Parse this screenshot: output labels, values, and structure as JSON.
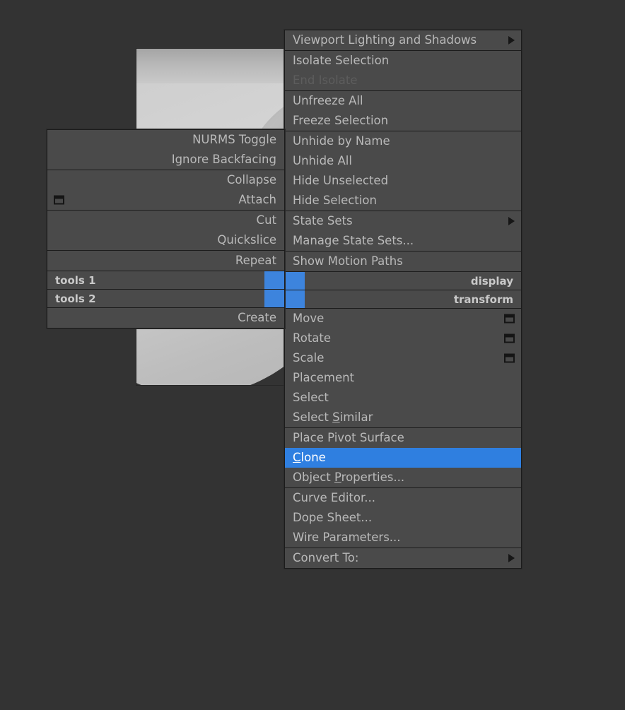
{
  "app": {
    "background_color": "#333333",
    "menu_bg_color": "#4a4a4a",
    "menu_text_color": "#b9b9b9",
    "disabled_text_color": "#5d5d5d",
    "highlight_color": "#2f7fe0",
    "swatch_color": "#3d84dd"
  },
  "viewport": {
    "object_name": "brake-disc-3d-object"
  },
  "quad_menu": {
    "upper_right": {
      "title": "display",
      "groups": [
        {
          "items": [
            {
              "label": "Viewport Lighting and Shadows",
              "submenu": true,
              "disabled": false
            }
          ]
        },
        {
          "items": [
            {
              "label": "Isolate Selection",
              "submenu": false,
              "disabled": false
            },
            {
              "label": "End Isolate",
              "submenu": false,
              "disabled": true
            }
          ]
        },
        {
          "items": [
            {
              "label": "Unfreeze All",
              "submenu": false,
              "disabled": false
            },
            {
              "label": "Freeze Selection",
              "submenu": false,
              "disabled": false
            }
          ]
        },
        {
          "items": [
            {
              "label": "Unhide by Name",
              "submenu": false,
              "disabled": false
            },
            {
              "label": "Unhide All",
              "submenu": false,
              "disabled": false
            },
            {
              "label": "Hide Unselected",
              "submenu": false,
              "disabled": false
            },
            {
              "label": "Hide Selection",
              "submenu": false,
              "disabled": false
            }
          ]
        },
        {
          "items": [
            {
              "label": "State Sets",
              "submenu": true,
              "disabled": false
            },
            {
              "label": "Manage State Sets...",
              "submenu": false,
              "disabled": false
            }
          ]
        },
        {
          "items": [
            {
              "label": "Show Motion Paths",
              "submenu": false,
              "disabled": false
            }
          ]
        }
      ]
    },
    "lower_right": {
      "title": "transform",
      "groups": [
        {
          "items": [
            {
              "label": "Move",
              "dialog": true
            },
            {
              "label": "Rotate",
              "dialog": true
            },
            {
              "label": "Scale",
              "dialog": true
            },
            {
              "label": "Placement",
              "dialog": false
            },
            {
              "label": "Select",
              "dialog": false
            },
            {
              "label_pre": "Select ",
              "label_accel": "S",
              "label_post": "imilar",
              "dialog": false
            }
          ]
        },
        {
          "items": [
            {
              "label": "Place Pivot Surface",
              "dialog": false
            },
            {
              "label_accel": "C",
              "label_post": "lone",
              "selected": true,
              "dialog": false
            },
            {
              "label_pre": "Object ",
              "label_accel": "P",
              "label_post": "roperties...",
              "dialog": false
            }
          ]
        },
        {
          "items": [
            {
              "label": "Curve Editor...",
              "dialog": false
            },
            {
              "label": "Dope Sheet...",
              "dialog": false
            },
            {
              "label": "Wire Parameters...",
              "dialog": false
            }
          ]
        },
        {
          "items": [
            {
              "label": "Convert To:",
              "submenu": true,
              "dialog": false
            }
          ]
        }
      ]
    },
    "upper_left": {
      "title": "tools 1",
      "groups": [
        {
          "items": [
            {
              "label": "NURMS Toggle",
              "dialog": false
            },
            {
              "label": "Ignore Backfacing",
              "dialog": false
            }
          ]
        },
        {
          "items": [
            {
              "label": "Collapse",
              "dialog": false
            },
            {
              "label": "Attach",
              "dialog": true
            }
          ]
        },
        {
          "items": [
            {
              "label": "Cut",
              "dialog": false
            },
            {
              "label": "Quickslice",
              "dialog": false
            }
          ]
        },
        {
          "items": [
            {
              "label": "Repeat",
              "dialog": false
            }
          ]
        }
      ]
    },
    "lower_left": {
      "title": "tools 2",
      "groups": [
        {
          "items": [
            {
              "label": "Create",
              "dialog": false
            }
          ]
        }
      ]
    }
  }
}
